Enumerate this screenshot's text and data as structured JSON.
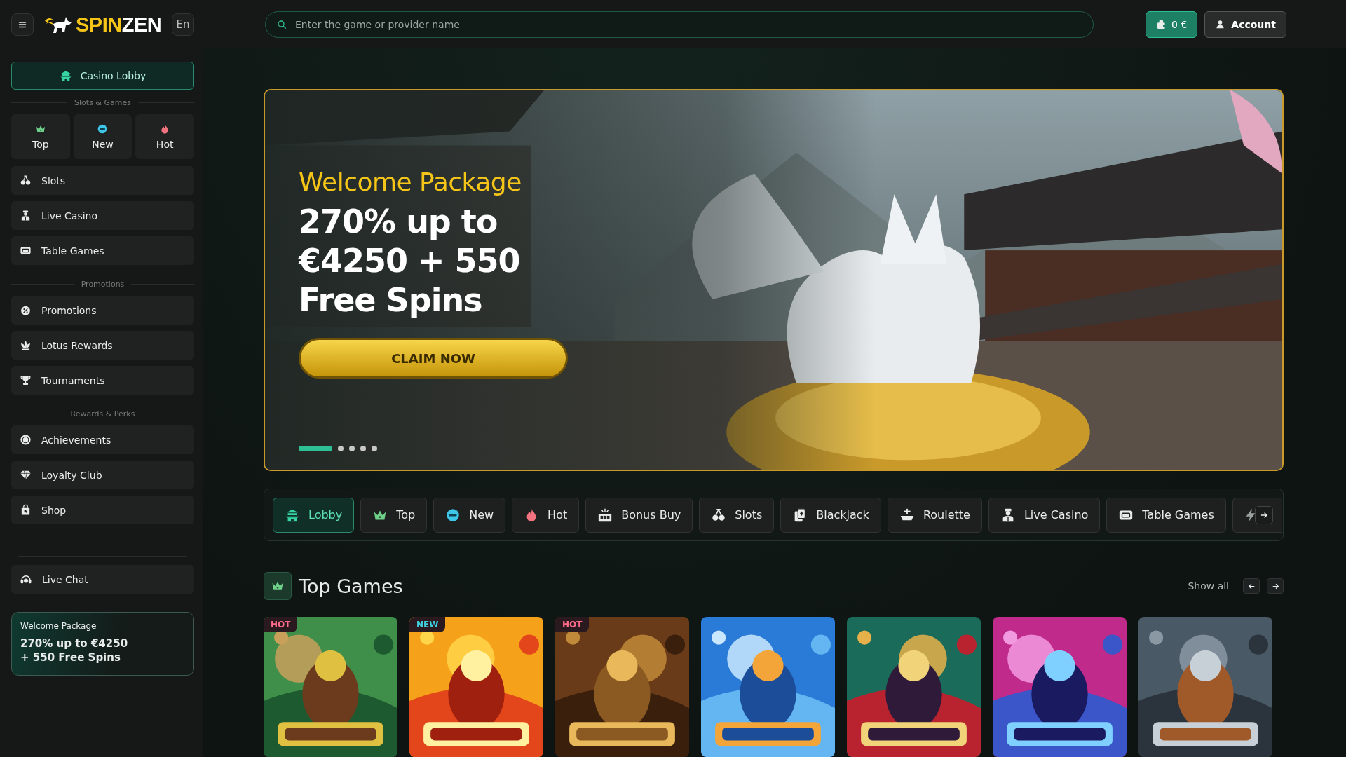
{
  "header": {
    "logo": {
      "part_1": "SPIN",
      "part_2": "ZEN"
    },
    "language": "En",
    "search": {
      "placeholder": "Enter the game or provider name"
    },
    "wallet": "0 €",
    "account": "Account"
  },
  "sidebar": {
    "lobby": {
      "label": "Casino Lobby",
      "selected": true
    },
    "sections": [
      {
        "title": "Slots & Games",
        "tiles": [
          "Top",
          "New",
          "Hot"
        ],
        "items": [
          "Slots",
          "Live Casino",
          "Table Games"
        ]
      },
      {
        "title": "Promotions",
        "items": [
          "Promotions",
          "Lotus Rewards",
          "Tournaments"
        ]
      },
      {
        "title": "Rewards & Perks",
        "items": [
          "Achievements",
          "Loyalty Club",
          "Shop"
        ]
      }
    ],
    "live_chat": "Live Chat",
    "promo": {
      "title": "Welcome Package",
      "text": "270% up to €4250\n+ 550 Free Spins"
    }
  },
  "banner": {
    "title": "Welcome Package",
    "headline": "270% up to €4250 + 550 Free Spins",
    "button": "CLAIM NOW",
    "dots": [
      {
        "selected": true
      },
      {
        "selected": false
      },
      {
        "selected": false
      },
      {
        "selected": false
      },
      {
        "selected": false
      }
    ]
  },
  "categories": [
    {
      "label": "Lobby",
      "selected": true
    },
    {
      "label": "Top",
      "selected": false
    },
    {
      "label": "New",
      "selected": false
    },
    {
      "label": "Hot",
      "selected": false
    },
    {
      "label": "Bonus Buy",
      "selected": false
    },
    {
      "label": "Slots",
      "selected": false
    },
    {
      "label": "Blackjack",
      "selected": false
    },
    {
      "label": "Roulette",
      "selected": false
    },
    {
      "label": "Live Casino",
      "selected": false
    },
    {
      "label": "Table Games",
      "selected": false
    }
  ],
  "top_games": {
    "title": "Top Games",
    "show_all": "Show all",
    "games": [
      {
        "kind": "picture",
        "badge": {
          "text": "HOT",
          "color": "#ff6b8a"
        }
      },
      {
        "kind": "picture",
        "badge": {
          "text": "NEW",
          "color": "#3fd0e0"
        }
      },
      {
        "kind": "picture",
        "badge": {
          "text": "HOT",
          "color": "#ff6b8a"
        }
      },
      {
        "kind": "picture"
      },
      {
        "kind": "picture"
      },
      {
        "kind": "picture"
      },
      {
        "kind": "picture"
      }
    ]
  }
}
